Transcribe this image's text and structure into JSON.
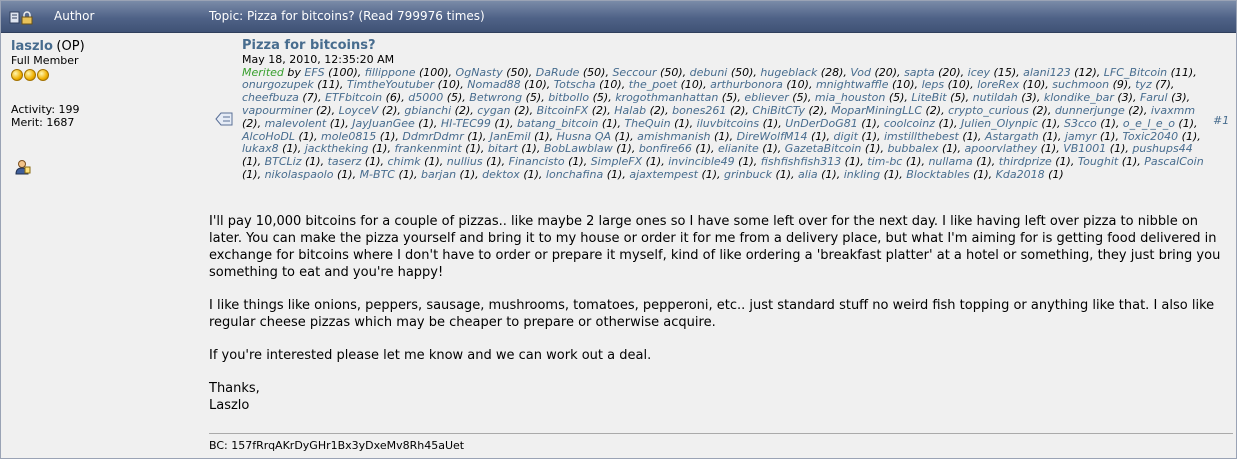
{
  "header": {
    "author_label": "Author",
    "topic_label": "Topic: Pizza for bitcoins?  (Read 799976 times)"
  },
  "poster": {
    "name": "laszlo",
    "op_tag": "(OP)",
    "rank": "Full Member",
    "stars": 3,
    "activity": "Activity: 199",
    "merit": "Merit: 1687"
  },
  "post": {
    "subject": "Pizza for bitcoins?",
    "date": "May 18, 2010, 12:35:20 AM",
    "number": "#1",
    "merited_label": "Merited",
    "by_label": "by",
    "merit_list": [
      [
        "EFS",
        "(100)"
      ],
      [
        "fillippone",
        "(100)"
      ],
      [
        "OgNasty",
        "(50)"
      ],
      [
        "DaRude",
        "(50)"
      ],
      [
        "Seccour",
        "(50)"
      ],
      [
        "debuni",
        "(50)"
      ],
      [
        "hugeblack",
        "(28)"
      ],
      [
        "Vod",
        "(20)"
      ],
      [
        "sapta",
        "(20)"
      ],
      [
        "icey",
        "(15)"
      ],
      [
        "alani123",
        "(12)"
      ],
      [
        "LFC_Bitcoin",
        "(11)"
      ],
      [
        "onurgozupek",
        "(11)"
      ],
      [
        "TimtheYoutuber",
        "(10)"
      ],
      [
        "Nomad88",
        "(10)"
      ],
      [
        "Totscha",
        "(10)"
      ],
      [
        "the_poet",
        "(10)"
      ],
      [
        "arthurbonora",
        "(10)"
      ],
      [
        "mnightwaffle",
        "(10)"
      ],
      [
        "leps",
        "(10)"
      ],
      [
        "loreRex",
        "(10)"
      ],
      [
        "suchmoon",
        "(9)"
      ],
      [
        "tyz",
        "(7)"
      ],
      [
        "cheefbuza",
        "(7)"
      ],
      [
        "ETFbitcoin",
        "(6)"
      ],
      [
        "d5000",
        "(5)"
      ],
      [
        "Betwrong",
        "(5)"
      ],
      [
        "bitbollo",
        "(5)"
      ],
      [
        "krogothmanhattan",
        "(5)"
      ],
      [
        "ebliever",
        "(5)"
      ],
      [
        "mia_houston",
        "(5)"
      ],
      [
        "LiteBit",
        "(5)"
      ],
      [
        "nutildah",
        "(3)"
      ],
      [
        "klondike_bar",
        "(3)"
      ],
      [
        "Farul",
        "(3)"
      ],
      [
        "vapourminer",
        "(2)"
      ],
      [
        "LoyceV",
        "(2)"
      ],
      [
        "gbianchi",
        "(2)"
      ],
      [
        "cygan",
        "(2)"
      ],
      [
        "BitcoinFX",
        "(2)"
      ],
      [
        "Halab",
        "(2)"
      ],
      [
        "bones261",
        "(2)"
      ],
      [
        "ChiBitCTy",
        "(2)"
      ],
      [
        "MoparMiningLLC",
        "(2)"
      ],
      [
        "crypto_curious",
        "(2)"
      ],
      [
        "dunnerjunge",
        "(2)"
      ],
      [
        "ivaxmm",
        "(2)"
      ],
      [
        "malevolent",
        "(1)"
      ],
      [
        "JayJuanGee",
        "(1)"
      ],
      [
        "HI-TEC99",
        "(1)"
      ],
      [
        "batang_bitcoin",
        "(1)"
      ],
      [
        "TheQuin",
        "(1)"
      ],
      [
        "iluvbitcoins",
        "(1)"
      ],
      [
        "UnDerDoG81",
        "(1)"
      ],
      [
        "coolcoinz",
        "(1)"
      ],
      [
        "Julien_Olynpic",
        "(1)"
      ],
      [
        "S3cco",
        "(1)"
      ],
      [
        "o_e_l_e_o",
        "(1)"
      ],
      [
        "AlcoHoDL",
        "(1)"
      ],
      [
        "mole0815",
        "(1)"
      ],
      [
        "DdmrDdmr",
        "(1)"
      ],
      [
        "JanEmil",
        "(1)"
      ],
      [
        "Husna QA",
        "(1)"
      ],
      [
        "amishmanish",
        "(1)"
      ],
      [
        "DireWolfM14",
        "(1)"
      ],
      [
        "digit",
        "(1)"
      ],
      [
        "imstillthebest",
        "(1)"
      ],
      [
        "Astargath",
        "(1)"
      ],
      [
        "jamyr",
        "(1)"
      ],
      [
        "Toxic2040",
        "(1)"
      ],
      [
        "lukax8",
        "(1)"
      ],
      [
        "jacktheking",
        "(1)"
      ],
      [
        "frankenmint",
        "(1)"
      ],
      [
        "bitart",
        "(1)"
      ],
      [
        "BobLawblaw",
        "(1)"
      ],
      [
        "bonfire66",
        "(1)"
      ],
      [
        "elianite",
        "(1)"
      ],
      [
        "GazetaBitcoin",
        "(1)"
      ],
      [
        "bubbalex",
        "(1)"
      ],
      [
        "apoorvlathey",
        "(1)"
      ],
      [
        "VB1001",
        "(1)"
      ],
      [
        "pushups44",
        "(1)"
      ],
      [
        "BTCLiz",
        "(1)"
      ],
      [
        "taserz",
        "(1)"
      ],
      [
        "chimk",
        "(1)"
      ],
      [
        "nullius",
        "(1)"
      ],
      [
        "Financisto",
        "(1)"
      ],
      [
        "SimpleFX",
        "(1)"
      ],
      [
        "invincible49",
        "(1)"
      ],
      [
        "fishfishfish313",
        "(1)"
      ],
      [
        "tim-bc",
        "(1)"
      ],
      [
        "nullama",
        "(1)"
      ],
      [
        "thirdprize",
        "(1)"
      ],
      [
        "Toughit",
        "(1)"
      ],
      [
        "PascalCoin",
        "(1)"
      ],
      [
        "nikolaspaolo",
        "(1)"
      ],
      [
        "M-BTC",
        "(1)"
      ],
      [
        "barjan",
        "(1)"
      ],
      [
        "dektox",
        "(1)"
      ],
      [
        "lonchafina",
        "(1)"
      ],
      [
        "ajaxtempest",
        "(1)"
      ],
      [
        "grinbuck",
        "(1)"
      ],
      [
        "alia",
        "(1)"
      ],
      [
        "inkling",
        "(1)"
      ],
      [
        "Blocktables",
        "(1)"
      ],
      [
        "Kda2018",
        "(1)"
      ]
    ],
    "body": [
      "I'll pay 10,000 bitcoins for a couple of pizzas.. like maybe 2 large ones so I have some left over for the next day.  I like having left over pizza to nibble on later.  You can make the pizza yourself and bring it to my house or order it for me from a delivery place, but what I'm aiming for is getting food delivered in exchange for bitcoins where I don't have to order or prepare it myself, kind of like ordering a 'breakfast platter' at a hotel or something, they just bring you something to eat and you're happy!",
      "I like things like onions, peppers, sausage, mushrooms, tomatoes, pepperoni, etc.. just standard stuff no weird fish topping or anything like that.  I also like regular cheese pizzas which may be cheaper to prepare or otherwise acquire.",
      "If you're interested please let me know and we can work out a deal.",
      "Thanks,\nLaszlo"
    ],
    "signature": "BC: 157fRrqAKrDyGHr1Bx3yDxeMv8Rh45aUet"
  }
}
